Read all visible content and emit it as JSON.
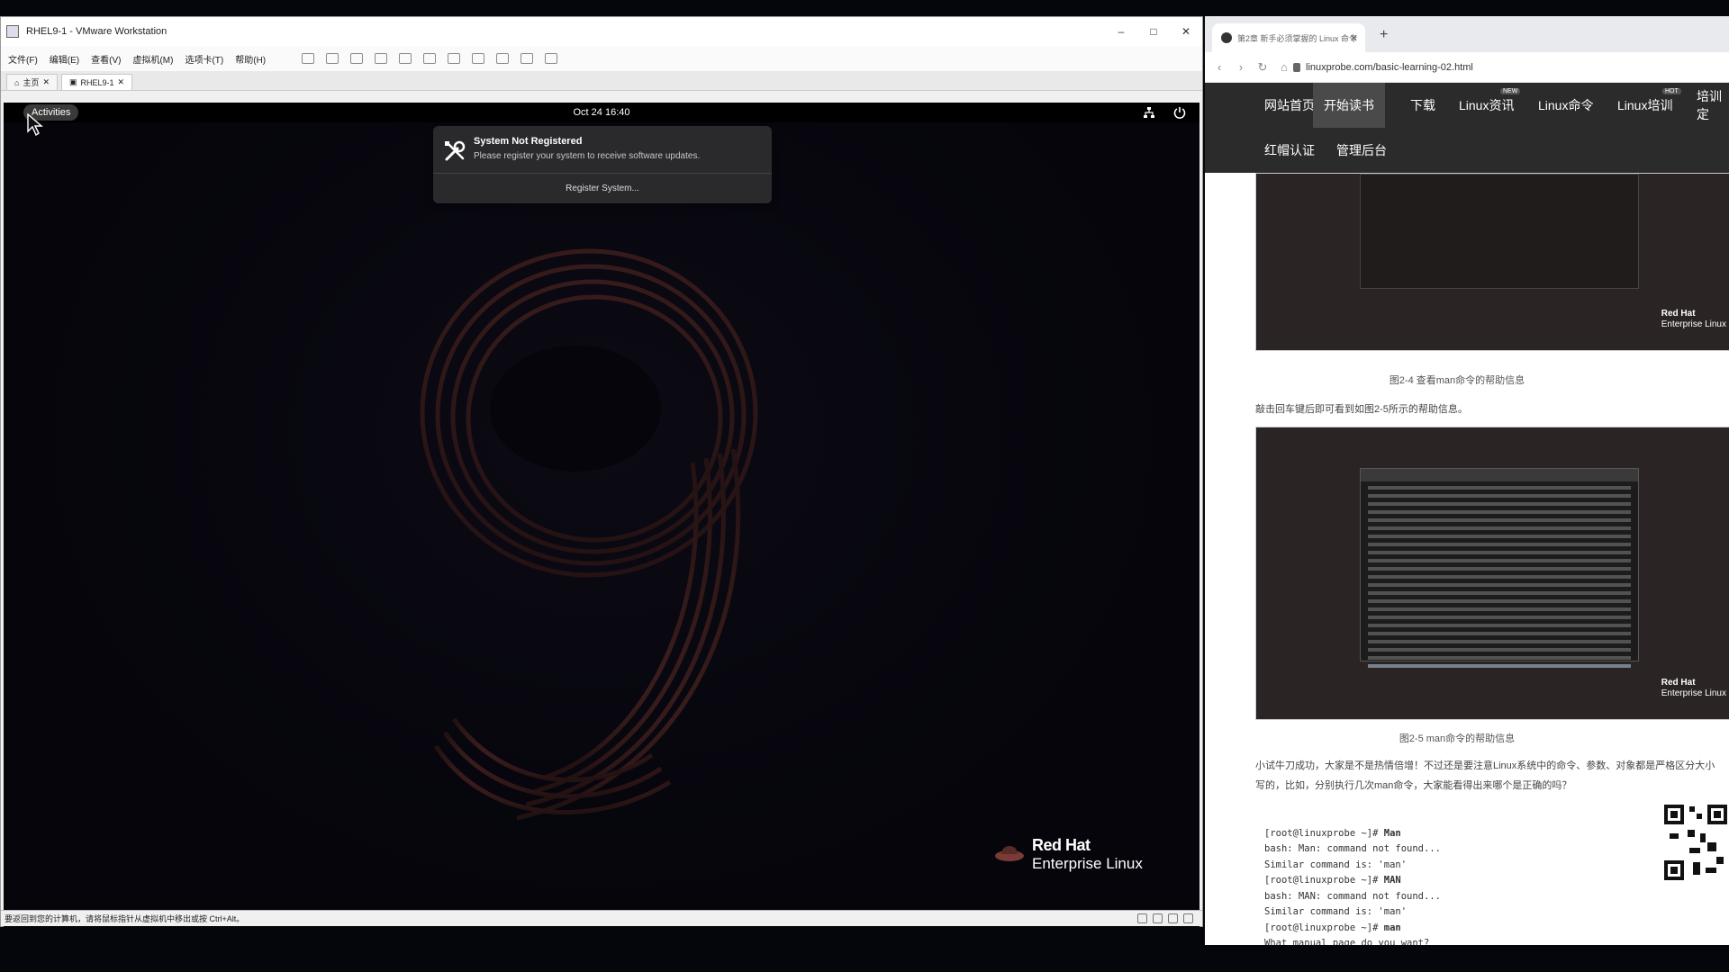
{
  "vmware": {
    "title": "RHEL9-1 - VMware Workstation",
    "menu": [
      "文件(F)",
      "编辑(E)",
      "查看(V)",
      "虚拟机(M)",
      "选项卡(T)",
      "帮助(H)"
    ],
    "tabs": [
      "主页",
      "RHEL9-1"
    ],
    "status_text": "要返回到您的计算机，请将鼠标指针从虚拟机中移出或按 Ctrl+Alt。"
  },
  "guest": {
    "activities_label": "Activities",
    "clock": "Oct 24  16:40",
    "notification": {
      "title": "System Not Registered",
      "body": "Please register your system to receive software updates.",
      "button": "Register System..."
    },
    "logo": {
      "line1": "Red Hat",
      "line2": "Enterprise Linux"
    }
  },
  "browser": {
    "tab_title": "第2章 新手必须掌握的 Linux 命令",
    "url": "linuxprobe.com/basic-learning-02.html",
    "nav": [
      {
        "label": "网站首页"
      },
      {
        "label": "开始读书",
        "active": true
      },
      {
        "label": "下载"
      },
      {
        "label": "Linux资讯",
        "badge": "NEW"
      },
      {
        "label": "Linux命令"
      },
      {
        "label": "Linux培训",
        "badge": "HOT"
      },
      {
        "label": "培训定"
      },
      {
        "label": "红帽认证"
      },
      {
        "label": "管理后台"
      }
    ],
    "figure1_caption": "图2-4 查看man命令的帮助信息",
    "para1": "敲击回车键后即可看到如图2-5所示的帮助信息。",
    "figure2_caption": "图2-5 man命令的帮助信息",
    "para2": "小试牛刀成功，大家是不是热情倍增！不过还是要注意Linux系统中的命令、参数、对象都是严格区分大小写的，比如，分别执行几次man命令，大家能看得出来哪个是正确的吗？",
    "figure_logo": {
      "line1": "Red Hat",
      "line2": "Enterprise Linux"
    },
    "code_lines": [
      {
        "prompt": "[root@linuxprobe ~]# ",
        "cmd": "Man"
      },
      {
        "text": "bash: Man: command not found..."
      },
      {
        "text": "Similar command is: 'man'"
      },
      {
        "prompt": "[root@linuxprobe ~]# ",
        "cmd": "MAN"
      },
      {
        "text": "bash: MAN: command not found..."
      },
      {
        "text": "Similar command is: 'man'"
      },
      {
        "prompt": "[root@linuxprobe ~]# ",
        "cmd": "man"
      },
      {
        "text": "What manual page do you want?"
      }
    ]
  },
  "colors": {
    "page_bg": "#05060c",
    "nav_bg": "#2b2b2b",
    "notif_bg": "#2a2a2c",
    "accent_nine": "#5a2e2a"
  }
}
